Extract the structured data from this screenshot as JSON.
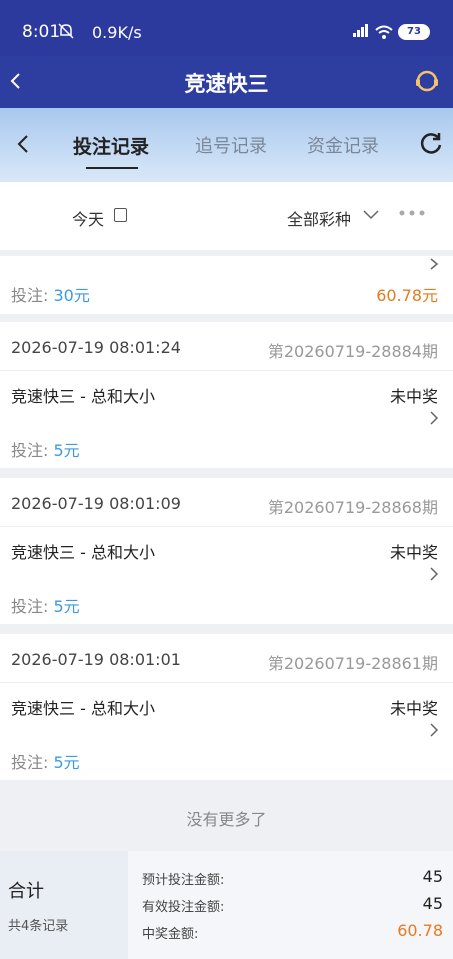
{
  "status_bar": {
    "time": "8:01",
    "speed": "0.9K/s",
    "battery": "73"
  },
  "app_bar": {
    "title": "竞速快三"
  },
  "tabs": {
    "items": [
      "投注记录",
      "追号记录",
      "资金记录"
    ]
  },
  "filters": {
    "date": "今天",
    "game": "全部彩种"
  },
  "partial_record": {
    "bet_label": "投注: ",
    "bet_amount": "30元",
    "win_amount": "60.78元"
  },
  "records": [
    {
      "time": "2026-07-19 08:01:24",
      "period": "第20260719-28884期",
      "game": "竞速快三 - 总和大小",
      "status": "未中奖",
      "bet_label": "投注: ",
      "bet_amount": "5元"
    },
    {
      "time": "2026-07-19 08:01:09",
      "period": "第20260719-28868期",
      "game": "竞速快三 - 总和大小",
      "status": "未中奖",
      "bet_label": "投注: ",
      "bet_amount": "5元"
    },
    {
      "time": "2026-07-19 08:01:01",
      "period": "第20260719-28861期",
      "game": "竞速快三 - 总和大小",
      "status": "未中奖",
      "bet_label": "投注: ",
      "bet_amount": "5元"
    }
  ],
  "no_more": "没有更多了",
  "summary": {
    "title": "合计",
    "count": "共4条记录",
    "expected_label": "预计投注金额:",
    "expected_value": "45",
    "valid_label": "有效投注金额:",
    "valid_value": "45",
    "win_label": "中奖金额:",
    "win_value": "60.78"
  }
}
